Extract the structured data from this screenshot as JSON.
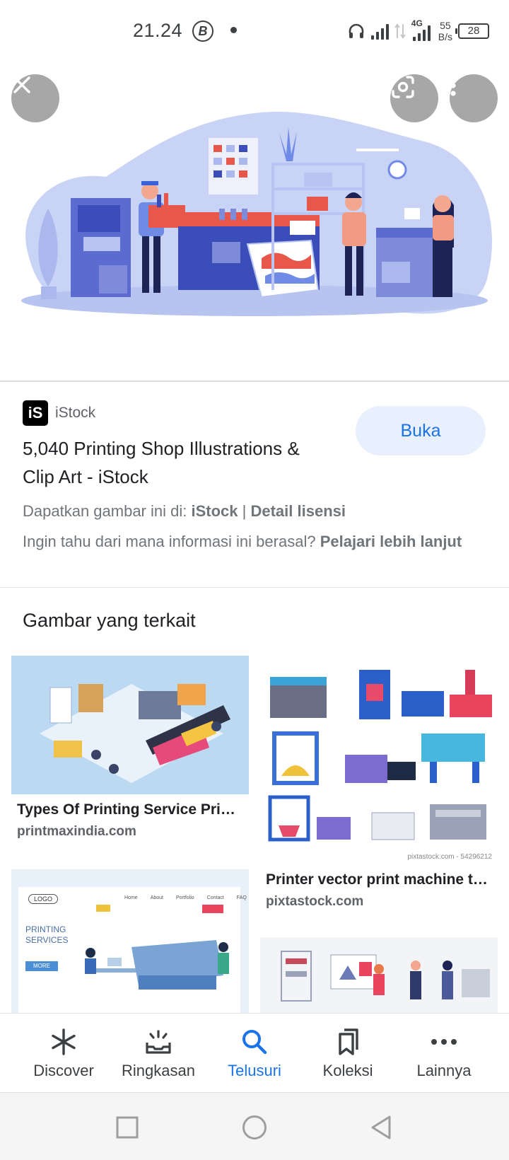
{
  "status_bar": {
    "time": "21.24",
    "b_icon": "B",
    "net_type": "4G",
    "net_speed_value": "55",
    "net_speed_unit": "B/s",
    "battery": "28"
  },
  "result": {
    "source_logo": "iS",
    "source_name": "iStock",
    "title": "5,040 Printing Shop Illustrations & Clip Art - iStock",
    "open_label": "Buka",
    "license_prefix": "Dapatkan gambar ini di:",
    "license_site": "iStock",
    "license_sep": "|",
    "license_link": "Detail lisensi",
    "info_question": "Ingin tahu dari mana informasi ini berasal?",
    "info_link": "Pelajari lebih lanjut"
  },
  "related": {
    "heading": "Gambar yang terkait",
    "items": [
      {
        "title": "Types Of Printing Service Pri…",
        "site": "printmaxindia.com"
      },
      {
        "title": "Printer vector print machine t…",
        "site": "pixtastock.com",
        "watermark": "pixtastock.com - 54296212"
      },
      {
        "title": "",
        "site": "",
        "logo_text": "LOGO",
        "nav": [
          "Home",
          "About",
          "Portfolio",
          "Contact",
          "FAQ"
        ],
        "headline": "PRINTING SERVICES",
        "button": "MORE"
      },
      {
        "title": "",
        "site": ""
      }
    ]
  },
  "bottom_nav": {
    "items": [
      {
        "label": "Discover",
        "icon": "asterisk-icon"
      },
      {
        "label": "Ringkasan",
        "icon": "inbox-icon"
      },
      {
        "label": "Telusuri",
        "icon": "search-icon",
        "active": true
      },
      {
        "label": "Koleksi",
        "icon": "bookmarks-icon"
      },
      {
        "label": "Lainnya",
        "icon": "more-horizontal-icon"
      }
    ]
  },
  "colors": {
    "accent": "#1a73e8",
    "accent_bg": "#e8f0fe",
    "hero_blob": "#c9d3f5",
    "hero_dark": "#3a4db8"
  }
}
